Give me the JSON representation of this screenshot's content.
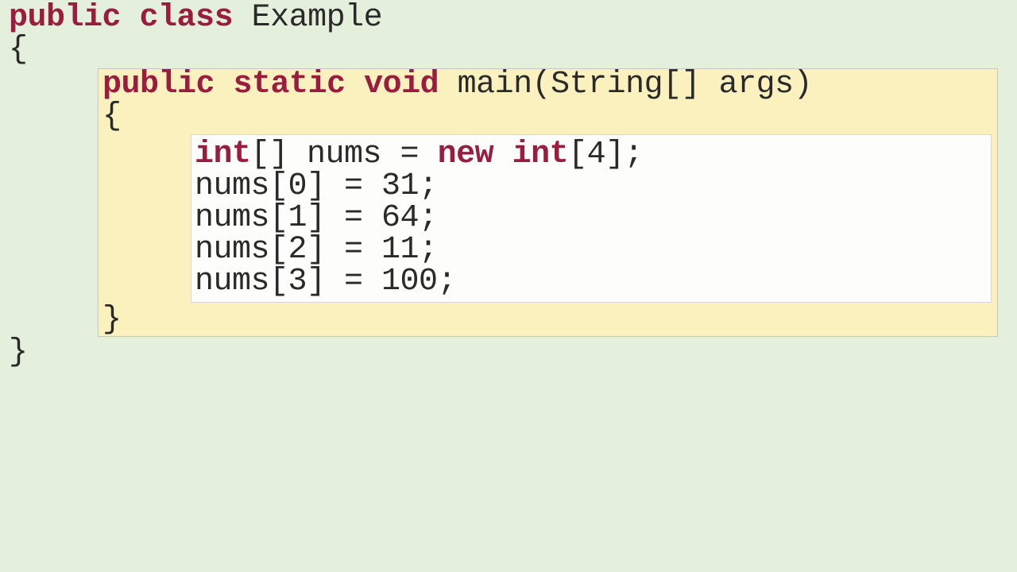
{
  "class": {
    "modifier": "public",
    "kw_class": "class",
    "name": "Example",
    "open_brace": "{",
    "close_brace": "}"
  },
  "method": {
    "modifier": "public",
    "kw_static": "static",
    "kw_void": "void",
    "sig_rest": " main(String[] args)",
    "open_brace": "{",
    "close_brace": "}"
  },
  "body": {
    "decl": {
      "type": "int",
      "after_type": "[] nums = ",
      "kw_new": "new",
      "after_new": " ",
      "type2": "int",
      "after_type2": "[4];"
    },
    "lines": [
      "nums[0] = 31;",
      "nums[1] = 64;",
      "nums[2] = 11;",
      "nums[3] = 100;"
    ]
  }
}
